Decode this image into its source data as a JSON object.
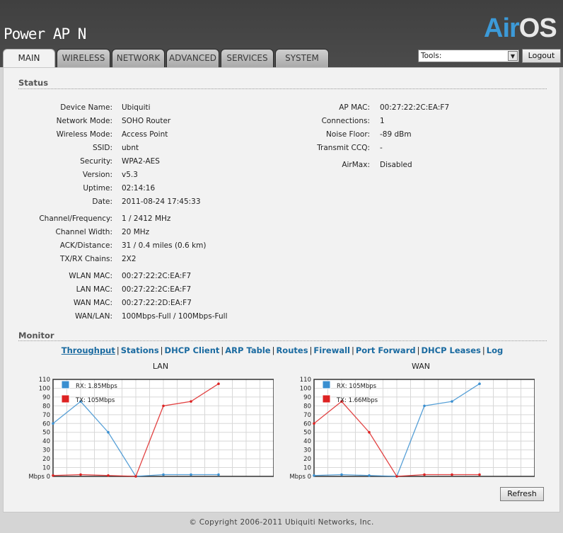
{
  "header": {
    "product_name": "Power AP N",
    "logo_air": "Air",
    "logo_os": "OS",
    "tabs": [
      {
        "label": "MAIN"
      },
      {
        "label": "WIRELESS"
      },
      {
        "label": "NETWORK"
      },
      {
        "label": "ADVANCED"
      },
      {
        "label": "SERVICES"
      },
      {
        "label": "SYSTEM"
      }
    ],
    "tools_value": "Tools:",
    "logout_label": "Logout"
  },
  "status": {
    "title": "Status",
    "left": [
      {
        "label": "Device Name:",
        "value": "Ubiquiti"
      },
      {
        "label": "Network Mode:",
        "value": "SOHO Router"
      },
      {
        "label": "Wireless Mode:",
        "value": "Access Point"
      },
      {
        "label": "SSID:",
        "value": "ubnt"
      },
      {
        "label": "Security:",
        "value": "WPA2-AES"
      },
      {
        "label": "Version:",
        "value": "v5.3"
      },
      {
        "label": "Uptime:",
        "value": "02:14:16"
      },
      {
        "label": "Date:",
        "value": "2011-08-24 17:45:33"
      },
      {
        "label": "Channel/Frequency:",
        "value": "1 / 2412 MHz"
      },
      {
        "label": "Channel Width:",
        "value": "20 MHz"
      },
      {
        "label": "ACK/Distance:",
        "value": "31 / 0.4 miles (0.6 km)"
      },
      {
        "label": "TX/RX Chains:",
        "value": "2X2"
      },
      {
        "label": "WLAN MAC:",
        "value": "00:27:22:2C:EA:F7"
      },
      {
        "label": "LAN MAC:",
        "value": "00:27:22:2C:EA:F7"
      },
      {
        "label": "WAN MAC:",
        "value": "00:27:22:2D:EA:F7"
      },
      {
        "label": "WAN/LAN:",
        "value": "100Mbps-Full / 100Mbps-Full"
      }
    ],
    "right": [
      {
        "label": "AP MAC:",
        "value": "00:27:22:2C:EA:F7"
      },
      {
        "label": "Connections:",
        "value": "1"
      },
      {
        "label": "Noise Floor:",
        "value": "-89 dBm"
      },
      {
        "label": "Transmit CCQ:",
        "value": "-"
      },
      {
        "label": "AirMax:",
        "value": "Disabled"
      }
    ]
  },
  "monitor": {
    "title": "Monitor",
    "links": [
      "Throughput",
      "Stations",
      "DHCP Client",
      "ARP Table",
      "Routes",
      "Firewall",
      "Port Forward",
      "DHCP Leases",
      "Log"
    ],
    "active_link": "Throughput"
  },
  "chart_data": [
    {
      "type": "line",
      "title": "LAN",
      "ylabel_unit": "Mbps",
      "yticks": [
        0,
        10,
        20,
        30,
        40,
        50,
        60,
        70,
        80,
        90,
        100,
        110
      ],
      "ylim": [
        0,
        110
      ],
      "x": [
        0,
        1,
        2,
        3,
        4,
        5,
        6,
        7
      ],
      "series": [
        {
          "name": "RX: 1.85Mbps",
          "color": "#3a8fd0",
          "values": [
            60,
            85,
            50,
            0,
            2,
            2,
            2,
            null
          ]
        },
        {
          "name": "TX: 105Mbps",
          "color": "#dd2222",
          "values": [
            1,
            2,
            1,
            0,
            80,
            85,
            105,
            null
          ]
        }
      ]
    },
    {
      "type": "line",
      "title": "WAN",
      "ylabel_unit": "Mbps",
      "yticks": [
        0,
        10,
        20,
        30,
        40,
        50,
        60,
        70,
        80,
        90,
        100,
        110
      ],
      "ylim": [
        0,
        110
      ],
      "x": [
        0,
        1,
        2,
        3,
        4,
        5,
        6,
        7
      ],
      "series": [
        {
          "name": "RX: 105Mbps",
          "color": "#3a8fd0",
          "values": [
            1,
            2,
            1,
            0,
            80,
            85,
            105,
            null
          ]
        },
        {
          "name": "TX: 1.66Mbps",
          "color": "#dd2222",
          "values": [
            60,
            85,
            50,
            0,
            2,
            2,
            2,
            null
          ]
        }
      ]
    }
  ],
  "refresh_label": "Refresh",
  "footer": "© Copyright 2006-2011 Ubiquiti Networks, Inc."
}
